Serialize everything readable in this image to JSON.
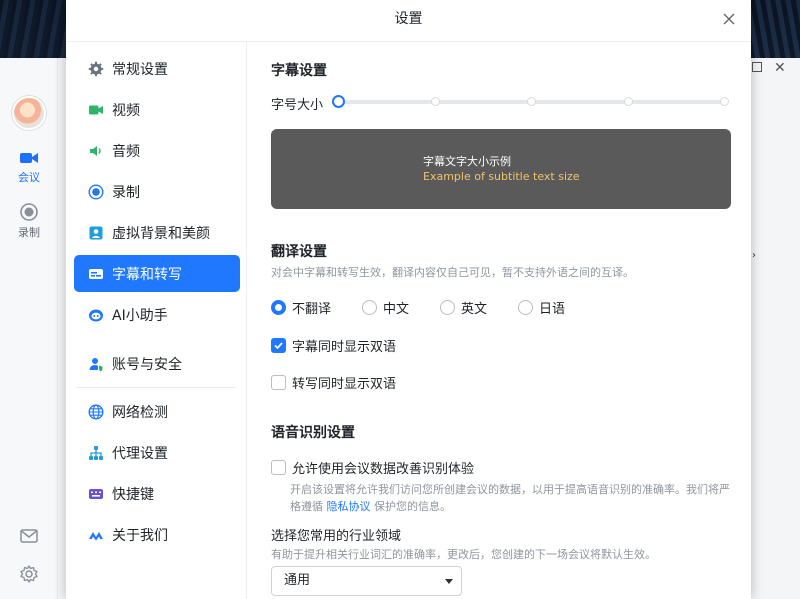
{
  "dialog": {
    "title": "设置"
  },
  "rail": {
    "items": [
      {
        "label": "会议",
        "icon": "video-camera-icon",
        "active": true
      },
      {
        "label": "录制",
        "icon": "record-icon",
        "active": false
      }
    ],
    "bottom_icons": [
      "mail-icon",
      "settings-gear-icon"
    ]
  },
  "nav": {
    "items": [
      {
        "label": "常规设置",
        "icon": "gear-icon"
      },
      {
        "label": "视频",
        "icon": "video-camera-icon"
      },
      {
        "label": "音频",
        "icon": "speaker-icon"
      },
      {
        "label": "录制",
        "icon": "record-icon"
      },
      {
        "label": "虚拟背景和美颜",
        "icon": "portrait-icon"
      },
      {
        "label": "字幕和转写",
        "icon": "subtitles-icon",
        "active": true
      },
      {
        "label": "AI小助手",
        "icon": "ai-assistant-icon"
      },
      {
        "label": "账号与安全",
        "icon": "account-security-icon"
      },
      {
        "label": "网络检测",
        "icon": "globe-icon"
      },
      {
        "label": "代理设置",
        "icon": "network-tree-icon"
      },
      {
        "label": "快捷键",
        "icon": "keyboard-icon"
      },
      {
        "label": "关于我们",
        "icon": "brand-logo-icon"
      }
    ]
  },
  "subtitle": {
    "section_title": "字幕设置",
    "font_size_label": "字号大小",
    "font_size_level": 0,
    "font_size_steps": 5,
    "preview_zh": "字幕文字大小示例",
    "preview_en": "Example of subtitle text size"
  },
  "translation": {
    "section_title": "翻译设置",
    "description": "对会中字幕和转写生效，翻译内容仅自己可见，暂不支持外语之间的互译。",
    "options": [
      {
        "label": "不翻译",
        "selected": true
      },
      {
        "label": "中文",
        "selected": false
      },
      {
        "label": "英文",
        "selected": false
      },
      {
        "label": "日语",
        "selected": false
      }
    ],
    "bilingual_subtitle": {
      "label": "字幕同时显示双语",
      "checked": true
    },
    "bilingual_transcript": {
      "label": "转写同时显示双语",
      "checked": false
    }
  },
  "speech": {
    "section_title": "语音识别设置",
    "allow_data": {
      "label": "允许使用会议数据改善识别体验",
      "checked": false
    },
    "desc_before": "开启该设置将允许我们访问您所创建会议的数据，以用于提高语音识别的准确率。我们将严格遵循 ",
    "privacy_link": "隐私协议",
    "desc_after": " 保护您的信息。",
    "industry_title": "选择您常用的行业领域",
    "industry_desc": "有助于提升相关行业词汇的准确率，更改后，您创建的下一场会议将默认生效。",
    "industry_value": "通用"
  },
  "colors": {
    "accent": "#1f78ff",
    "preview_bg": "#5a5a5a",
    "preview_en": "#f1c36b"
  }
}
